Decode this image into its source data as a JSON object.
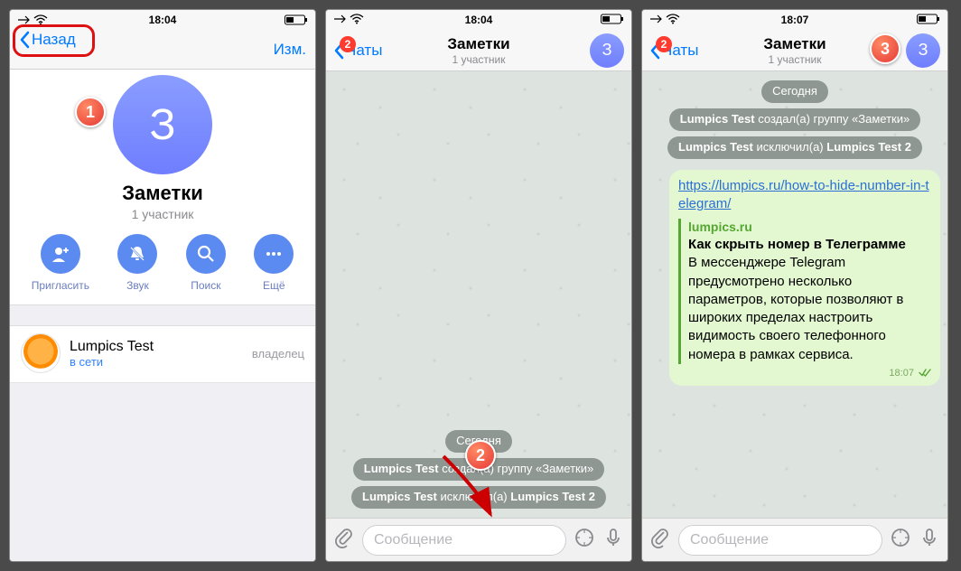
{
  "status": {
    "time1": "18:04",
    "time2": "18:04",
    "time3": "18:07"
  },
  "p1": {
    "back": "Назад",
    "edit": "Изм.",
    "avatar_letter": "З",
    "title": "Заметки",
    "subtitle": "1 участник",
    "actions": {
      "invite": "Пригласить",
      "sound": "Звук",
      "search": "Поиск",
      "more": "Ещё"
    },
    "member": {
      "name": "Lumpics Test",
      "status": "в сети",
      "role": "владелец"
    },
    "marker": "1"
  },
  "p2": {
    "back": "Чаты",
    "unread": "2",
    "title": "Заметки",
    "subtitle": "1 участник",
    "avatar_letter": "З",
    "sys_date": "Сегодня",
    "sys1_pre": "Lumpics Test",
    "sys1_mid": " создал(а) группу ",
    "sys1_post": "«Заметки»",
    "sys2_pre": "Lumpics Test",
    "sys2_mid": " исключил(а) ",
    "sys2_post": "Lumpics Test 2",
    "placeholder": "Сообщение",
    "marker": "2"
  },
  "p3": {
    "back": "Чаты",
    "unread": "2",
    "title": "Заметки",
    "subtitle": "1 участник",
    "avatar_letter": "З",
    "sys_date": "Сегодня",
    "sys1_pre": "Lumpics Test",
    "sys1_mid": " создал(а) группу ",
    "sys1_post": "«Заметки»",
    "sys2_pre": "Lumpics Test",
    "sys2_mid": " исключил(а) ",
    "sys2_post": "Lumpics Test 2",
    "link": "https://lumpics.ru/how-to-hide-number-in-telegram/",
    "prev_site": "lumpics.ru",
    "prev_title": "Как скрыть номер в Телеграмме",
    "prev_desc": "В мессенджере Telegram предусмотрено несколько параметров, которые позволяют в широких пределах настроить видимость своего телефонного номера в рамках сервиса.",
    "msg_time": "18:07",
    "placeholder": "Сообщение",
    "marker": "3"
  }
}
